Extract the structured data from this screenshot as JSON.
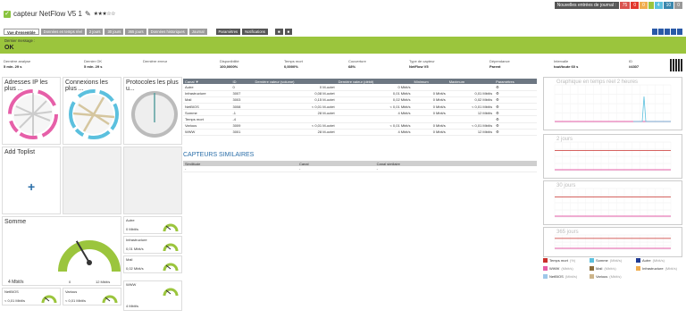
{
  "header": {
    "title": "capteur NetFlow V5 1",
    "stars": "★★★☆☆",
    "edit_icon": "pencil-icon",
    "badges_label": "Nouvelles entrées de journal :",
    "badges": [
      {
        "t": "75",
        "c": "#d9534f"
      },
      {
        "t": "0",
        "c": "#e2362b"
      },
      {
        "t": "0",
        "c": "#f0ad4e"
      },
      {
        "t": "",
        "c": "#9bc53d"
      },
      {
        "t": "4",
        "c": "#5bc0de"
      },
      {
        "t": "10",
        "c": "#3a87ad"
      },
      {
        "t": "0",
        "c": "#999"
      }
    ]
  },
  "tabs": [
    "Vue d'ensemble",
    "Données en temps réel",
    "2 jours",
    "30 jours",
    "365 jours",
    "Données historiques",
    "Journal",
    "Paramètres",
    "Notifications"
  ],
  "message": {
    "label": "Dernier message :",
    "text": "OK"
  },
  "info": [
    {
      "k": "Dernière analyse",
      "v": "5 min. 29 s"
    },
    {
      "k": "Dernier OK",
      "v": "5 min. 29 s"
    },
    {
      "k": "Dernière erreur",
      "v": ""
    },
    {
      "k": "Disponibilité",
      "v": "100,0000%"
    },
    {
      "k": "Temps mort",
      "v": "0,0000%"
    },
    {
      "k": "Couverture",
      "v": "68%"
    },
    {
      "k": "Type de capteur",
      "v": "NetFlow V5"
    },
    {
      "k": "Dépendance",
      "v": "Parent"
    },
    {
      "k": "Intervalle",
      "v": "tout/toute 60 s"
    },
    {
      "k": "ID",
      "v": "#4307"
    }
  ],
  "panels": {
    "p1": "Adresses IP les plus ...",
    "p2": "Connexions les plus ...",
    "p3": "Protocoles les plus u...",
    "p4": "Add Toplist",
    "somme": "Somme"
  },
  "gauge_main": {
    "value": "4 Mbit/s",
    "min": "0",
    "max": "12 Mbit/s",
    "fraction": 0.33
  },
  "small_gauges": [
    {
      "name": "Autre",
      "value": "0 Mbit/s"
    },
    {
      "name": "Infrastructure",
      "value": "0,01 Mbit/s"
    },
    {
      "name": "Mail",
      "value": "0,02 Mbit/s"
    },
    {
      "name": "WWW",
      "value": "4 Mbit/s"
    },
    {
      "name": "NetBIOS",
      "value": "< 0,01 Mbit/s"
    },
    {
      "name": "Various",
      "value": "< 0,01 Mbit/s"
    }
  ],
  "table": {
    "headers": [
      "Canal ▼",
      "ID",
      "Dernière valeur (volume)",
      "Dernière valeur (débit)",
      "Minimum",
      "Maximum",
      "Paramètres"
    ],
    "rows": [
      [
        "Autre",
        "0",
        "0 M-octet",
        "0 Mbit/s",
        "",
        "",
        ""
      ],
      [
        "Infrastructure",
        "3007",
        "0,08 M-octet",
        "0,01 Mbit/s",
        "0 Mbit/s",
        "0,01 Mbit/s",
        ""
      ],
      [
        "Mail",
        "3003",
        "0,15 M-octet",
        "0,02 Mbit/s",
        "0 Mbit/s",
        "0,02 Mbit/s",
        ""
      ],
      [
        "NetBIOS",
        "3008",
        "< 0,01 M-octet",
        "< 0,01 Mbit/s",
        "0 Mbit/s",
        "< 0,01 Mbit/s",
        ""
      ],
      [
        "Somme",
        "-1",
        "28 M-octet",
        "4 Mbit/s",
        "0 Mbit/s",
        "12 Mbit/s",
        ""
      ],
      [
        "Temps mort",
        "-4",
        "",
        "",
        "",
        "",
        ""
      ],
      [
        "Various",
        "3009",
        "< 0,01 M-octet",
        "< 0,01 Mbit/s",
        "0 Mbit/s",
        "< 0,01 Mbit/s",
        ""
      ],
      [
        "WWW",
        "3001",
        "28 M-octet",
        "4 Mbit/s",
        "0 Mbit/s",
        "12 Mbit/s",
        ""
      ]
    ]
  },
  "similar": {
    "title": "CAPTEURS SIMILAIRES",
    "headers": [
      "Similitude",
      "Canal",
      "Canal similaire"
    ],
    "rows": [
      [
        "-",
        "-",
        "-"
      ]
    ]
  },
  "charts": [
    {
      "title": "Graphique en temps réel 2 heures"
    },
    {
      "title": "2 jours"
    },
    {
      "title": "30 jours"
    },
    {
      "title": "365 jours"
    }
  ],
  "legend": [
    {
      "n": "Temps mort",
      "u": "(%)",
      "c": "#c9302c"
    },
    {
      "n": "Somme",
      "u": "(Mbit/s)",
      "c": "#5bc0de"
    },
    {
      "n": "Autre",
      "u": "(Mbit/s)",
      "c": "#1f3a93"
    },
    {
      "n": "WWW",
      "u": "(Mbit/s)",
      "c": "#e65fa8"
    },
    {
      "n": "Mail",
      "u": "(Mbit/s)",
      "c": "#8a6d3b"
    },
    {
      "n": "Infrastructure",
      "u": "(Mbit/s)",
      "c": "#f0ad4e"
    },
    {
      "n": "NetBIOS",
      "u": "(Mbit/s)",
      "c": "#9ec7e9"
    },
    {
      "n": "Various",
      "u": "(Mbit/s)",
      "c": "#ccb48a"
    }
  ]
}
